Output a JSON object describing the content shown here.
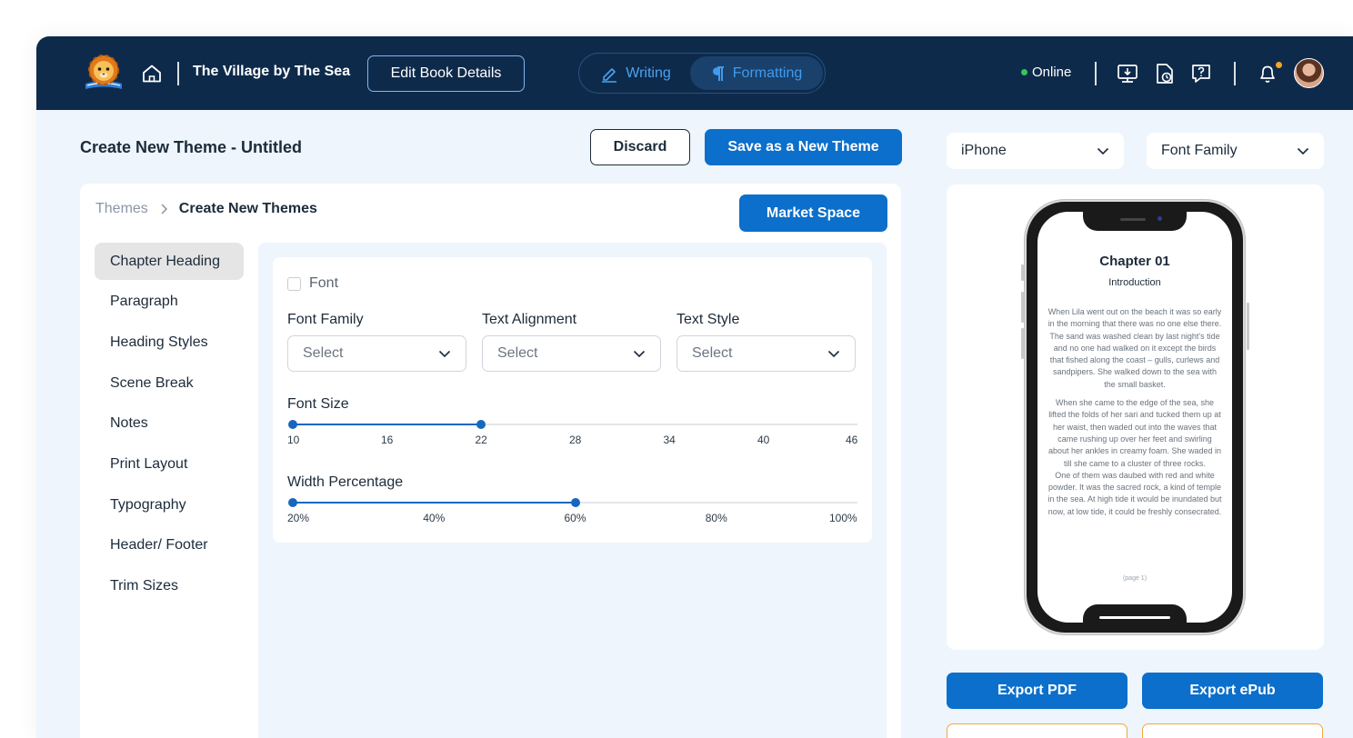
{
  "topbar": {
    "book_title": "The Village by The Sea",
    "edit_book_label": "Edit Book Details",
    "mode_writing_label": "Writing",
    "mode_formatting_label": "Formatting",
    "status_text": "Online",
    "status_color": "#34c759",
    "icons": [
      "home-icon",
      "monitor-icon",
      "document-icon",
      "help-icon",
      "bell-icon"
    ]
  },
  "header": {
    "page_title": "Create New Theme - Untitled",
    "discard_label": "Discard",
    "save_label": "Save as a New Theme"
  },
  "panel": {
    "breadcrumb": [
      "Themes",
      "Create New Themes"
    ],
    "market_label": "Market Space",
    "side_menu": [
      "Chapter Heading",
      "Paragraph",
      "Heading Styles",
      "Scene Break",
      "Notes",
      "Print Layout",
      "Typography",
      "Header/ Footer",
      "Trim Sizes"
    ],
    "active_menu": "Chapter Heading"
  },
  "font_card": {
    "font_checkbox_label": "Font",
    "font_checkbox_checked": false,
    "fields": [
      {
        "label": "Font Family",
        "value": "Select"
      },
      {
        "label": "Text Alignment",
        "value": "Select"
      },
      {
        "label": "Text Style",
        "value": "Select"
      }
    ],
    "font_size": {
      "label": "Font Size",
      "ticks": [
        "10",
        "16",
        "22",
        "28",
        "34",
        "40",
        "46"
      ],
      "min": 10,
      "max": 46,
      "range": [
        10,
        22
      ]
    },
    "width_percentage": {
      "label": "Width Percentage",
      "ticks": [
        "20%",
        "40%",
        "60%",
        "80%",
        "100%"
      ],
      "min": 20,
      "max": 100,
      "range": [
        20,
        60
      ]
    }
  },
  "preview": {
    "device": "iPhone",
    "font_family": "Font Family",
    "chapter_title": "Chapter 01",
    "chapter_subtitle": "Introduction",
    "paragraphs": [
      "When Lila went out on the beach it was so early in the morning that there was no one else there. The sand was washed clean by last night's tide and no one had walked on it except the birds that fished along the coast – gulls, curlews and sandpipers. She walked down to the sea with the small basket.",
      "When she came to the edge of the sea, she lifted the folds of her sari and tucked them up at her waist, then waded out into the waves that came rushing up over her feet and swirling about her ankles in creamy foam. She waded in till she came to a cluster of three rocks.",
      "One of them was daubed with red and white powder. It was the sacred rock, a kind of temple in the sea. At high tide it would be inundated but now, at low tide, it could be freshly consecrated."
    ],
    "page_label": "(page 1)",
    "export_pdf_label": "Export PDF",
    "export_epub_label": "Export ePub"
  },
  "colors": {
    "topbar_bg": "#0e2a4b",
    "accent": "#0b6fcb",
    "page_bg": "#eef5fd",
    "nav_border": "#f2a93b"
  }
}
